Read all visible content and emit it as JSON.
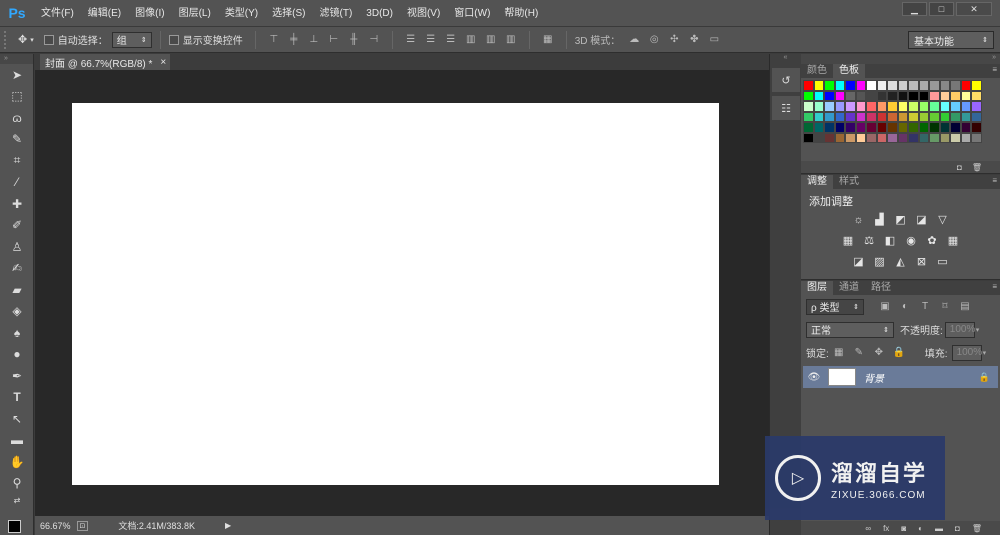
{
  "app": {
    "logo": "Ps"
  },
  "menu": [
    "文件(F)",
    "编辑(E)",
    "图像(I)",
    "图层(L)",
    "类型(Y)",
    "选择(S)",
    "滤镜(T)",
    "3D(D)",
    "视图(V)",
    "窗口(W)",
    "帮助(H)"
  ],
  "window_controls": {
    "minimize": "▁",
    "maximize": "□",
    "close": "✕"
  },
  "options": {
    "auto_select_label": "自动选择：",
    "group_select_value": "组",
    "show_transform_label": "显示变换控件",
    "mode_3d_label": "3D 模式：",
    "workspace": "基本功能"
  },
  "document": {
    "tab_title": "封面 @ 66.7%(RGB/8) *",
    "tab_close": "×",
    "zoom": "66.67%",
    "doc_info": "文档:2.41M/383.8K"
  },
  "panels": {
    "color_tabs": [
      "颜色",
      "色板"
    ],
    "adjust_tabs": [
      "调整",
      "样式"
    ],
    "adjust_title": "添加调整",
    "layer_tabs": [
      "图层",
      "通道",
      "路径"
    ],
    "layer_filter": "ρ 类型",
    "blend_mode": "正常",
    "opacity_label": "不透明度:",
    "opacity_value": "100%",
    "lock_label": "锁定:",
    "fill_label": "填充:",
    "fill_value": "100%",
    "layer_name": "背景"
  },
  "swatch_colors": [
    "#ff0000",
    "#ffff00",
    "#00ff00",
    "#00ffff",
    "#0000ff",
    "#ff00ff",
    "#ffffff",
    "#eeeeee",
    "#dddddd",
    "#cccccc",
    "#bbbbbb",
    "#aaaaaa",
    "#999999",
    "#888888",
    "#777777",
    "#ff0000",
    "#ffff00",
    "#00ff00",
    "#00ffff",
    "#0000ff",
    "#ff00ff",
    "#666666",
    "#555555",
    "#444444",
    "#333333",
    "#222222",
    "#111111",
    "#000000",
    "#000000",
    "#ff9999",
    "#ffcc99",
    "#ffcc66",
    "#ffff99",
    "#ffdd66",
    "#ccffcc",
    "#99ffcc",
    "#99ccff",
    "#9999ff",
    "#cc99ff",
    "#ff99cc",
    "#ff6666",
    "#ff9966",
    "#ffcc33",
    "#ffff66",
    "#ccff66",
    "#99ff66",
    "#66ff99",
    "#66ffff",
    "#66ccff",
    "#6699ff",
    "#9966ff",
    "#33cc66",
    "#33cccc",
    "#3399cc",
    "#3366cc",
    "#6633cc",
    "#cc33cc",
    "#cc3366",
    "#cc3333",
    "#cc6633",
    "#cc9933",
    "#cccc33",
    "#99cc33",
    "#66cc33",
    "#33cc33",
    "#339966",
    "#339999",
    "#336699",
    "#006633",
    "#006666",
    "#003366",
    "#000066",
    "#330066",
    "#660066",
    "#660033",
    "#660000",
    "#663300",
    "#666600",
    "#336600",
    "#006600",
    "#003300",
    "#003333",
    "#000033",
    "#330033",
    "#330000",
    "#000000",
    "#444444",
    "#663333",
    "#996633",
    "#cc9966",
    "#ffcc99",
    "#996666",
    "#cc6666",
    "#996699",
    "#663366",
    "#333366",
    "#336666",
    "#669966",
    "#999966",
    "#ccccaa",
    "#aaaaaa",
    "#777777"
  ],
  "icons": {
    "move": "move-icon",
    "marquee": "marquee-icon",
    "lasso": "lasso-icon",
    "quick_select": "quick-select-icon",
    "crop": "crop-icon",
    "eyedropper": "eyedropper-icon",
    "healing": "healing-brush-icon",
    "brush": "brush-icon",
    "stamp": "clone-stamp-icon",
    "history": "history-brush-icon",
    "eraser": "eraser-icon",
    "bucket": "paint-bucket-icon",
    "blur": "blur-icon",
    "dodge": "dodge-icon",
    "pen": "pen-icon",
    "type": "type-icon",
    "path_select": "path-select-icon",
    "shape": "rectangle-shape-icon",
    "hand": "hand-icon",
    "zoom": "zoom-icon"
  },
  "watermark": {
    "brand_cn": "溜溜自学",
    "brand_en": "ZIXUE.3066.COM"
  }
}
